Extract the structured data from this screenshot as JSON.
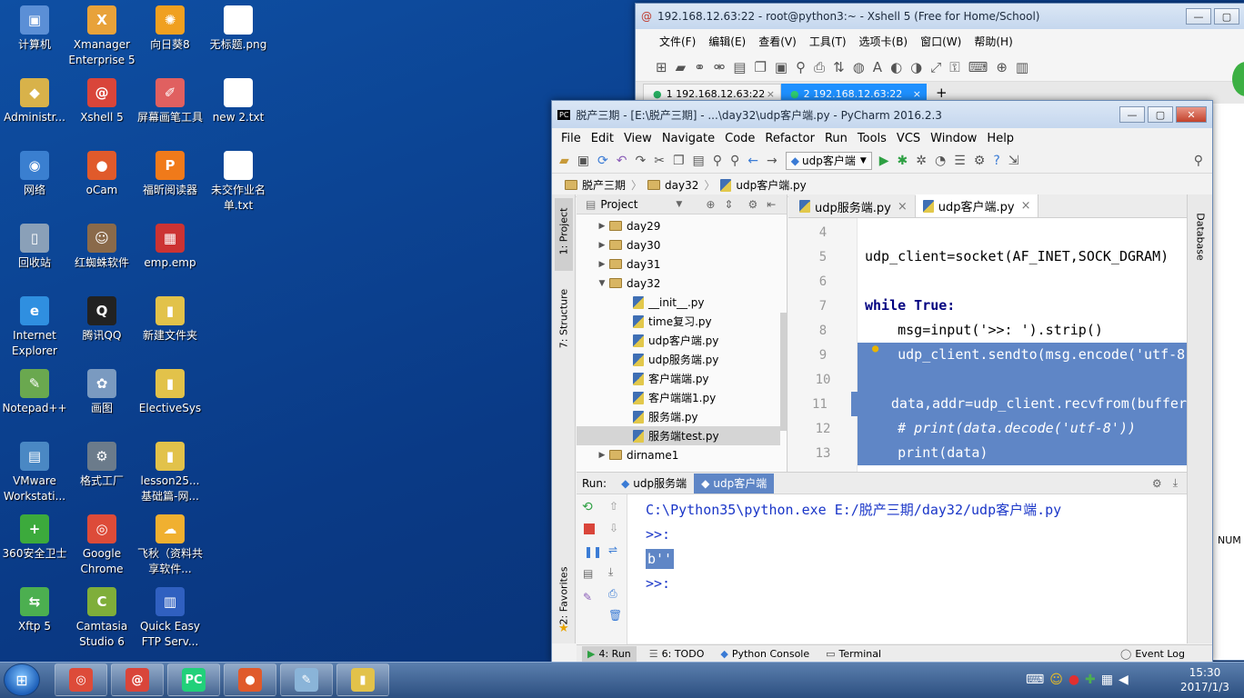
{
  "desktop": {
    "icons": [
      {
        "label": "计算机",
        "glyph": "▣",
        "color": "#5b8fd6"
      },
      {
        "label": "Administr...",
        "glyph": "◆",
        "color": "#d8b24a"
      },
      {
        "label": "网络",
        "glyph": "◉",
        "color": "#3a7fd0"
      },
      {
        "label": "回收站",
        "glyph": "▯",
        "color": "#8aa0b8"
      },
      {
        "label": "Internet Explorer",
        "glyph": "e",
        "color": "#2f8fe0"
      },
      {
        "label": "Notepad++",
        "glyph": "✎",
        "color": "#6aa84f"
      },
      {
        "label": "VMware Workstati...",
        "glyph": "▤",
        "color": "#4a88c4"
      },
      {
        "label": "360安全卫士",
        "glyph": "+",
        "color": "#3caa3c"
      },
      {
        "label": "Xftp 5",
        "glyph": "⇆",
        "color": "#4caf50"
      },
      {
        "label": "Xmanager Enterprise 5",
        "glyph": "X",
        "color": "#e8a23a"
      },
      {
        "label": "Xshell 5",
        "glyph": "@",
        "color": "#d9453a"
      },
      {
        "label": "oCam",
        "glyph": "●",
        "color": "#e05a2b"
      },
      {
        "label": "红蜘蛛软件",
        "glyph": "☺",
        "color": "#8a6a4a"
      },
      {
        "label": "腾讯QQ",
        "glyph": "Q",
        "color": "#222222"
      },
      {
        "label": "画图",
        "glyph": "✿",
        "color": "#7a9ac0"
      },
      {
        "label": "格式工厂",
        "glyph": "⚙",
        "color": "#6b7b8b"
      },
      {
        "label": "Google Chrome",
        "glyph": "◎",
        "color": "#dd4b39"
      },
      {
        "label": "Camtasia Studio 6",
        "glyph": "C",
        "color": "#7fae3a"
      },
      {
        "label": "向日葵8",
        "glyph": "✺",
        "color": "#f0a020"
      },
      {
        "label": "屏幕画笔工具",
        "glyph": "✐",
        "color": "#e06060"
      },
      {
        "label": "福昕阅读器",
        "glyph": "P",
        "color": "#f07a1a"
      },
      {
        "label": "emp.emp",
        "glyph": "▦",
        "color": "#cc3333"
      },
      {
        "label": "新建文件夹",
        "glyph": "▮",
        "color": "#e2c24a"
      },
      {
        "label": "ElectiveSys",
        "glyph": "▮",
        "color": "#e2c24a"
      },
      {
        "label": "lesson25...基础篇-网...",
        "glyph": "▮",
        "color": "#e2c24a"
      },
      {
        "label": "飞秋（资料共享软件...",
        "glyph": "☁",
        "color": "#f0b030"
      },
      {
        "label": "Quick Easy FTP Serv...",
        "glyph": "▥",
        "color": "#3060c0"
      },
      {
        "label": "无标题.png",
        "glyph": "▭",
        "color": "#ffffff"
      },
      {
        "label": "new 2.txt",
        "glyph": "▤",
        "color": "#ffffff"
      },
      {
        "label": "未交作业名单.txt",
        "glyph": "▤",
        "color": "#ffffff"
      }
    ]
  },
  "xshell": {
    "title": "192.168.12.63:22 - root@python3:~ - Xshell 5 (Free for Home/School)",
    "menu": [
      "文件(F)",
      "编辑(E)",
      "查看(V)",
      "工具(T)",
      "选项卡(B)",
      "窗口(W)",
      "帮助(H)"
    ],
    "tabs": [
      {
        "label": "1 192.168.12.63:22",
        "close": "×"
      },
      {
        "label": "2 192.168.12.63:22",
        "close": "×"
      }
    ],
    "add_tab": "+",
    "right_edge_text": "NUM"
  },
  "pycharm": {
    "title": "脱产三期 - [E:\\脱产三期] - ...\\day32\\udp客户端.py - PyCharm 2016.2.3",
    "menu": [
      "File",
      "Edit",
      "View",
      "Navigate",
      "Code",
      "Refactor",
      "Run",
      "Tools",
      "VCS",
      "Window",
      "Help"
    ],
    "run_config": "udp客户端",
    "breadcrumb": [
      "脱产三期",
      "day32",
      "udp客户端.py"
    ],
    "left_strip": {
      "project": "1: Project",
      "structure": "7: Structure",
      "favorites": "2: Favorites"
    },
    "right_strip": "Database",
    "project_header": "Project",
    "tree": [
      {
        "label": "day29",
        "kind": "folder",
        "depth": 0,
        "expanded": false
      },
      {
        "label": "day30",
        "kind": "folder",
        "depth": 0,
        "expanded": false
      },
      {
        "label": "day31",
        "kind": "folder",
        "depth": 0,
        "expanded": false
      },
      {
        "label": "day32",
        "kind": "folder",
        "depth": 0,
        "expanded": true
      },
      {
        "label": "__init__.py",
        "kind": "py",
        "depth": 1
      },
      {
        "label": "time复习.py",
        "kind": "py",
        "depth": 1
      },
      {
        "label": "udp客户端.py",
        "kind": "py",
        "depth": 1
      },
      {
        "label": "udp服务端.py",
        "kind": "py",
        "depth": 1
      },
      {
        "label": "客户端端.py",
        "kind": "py",
        "depth": 1
      },
      {
        "label": "客户端端1.py",
        "kind": "py",
        "depth": 1
      },
      {
        "label": "服务端.py",
        "kind": "py",
        "depth": 1
      },
      {
        "label": "服务端test.py",
        "kind": "py",
        "depth": 1,
        "selected": true
      },
      {
        "label": "dirname1",
        "kind": "folder",
        "depth": 0,
        "expanded": false
      }
    ],
    "editor_tabs": [
      {
        "label": "udp服务端.py",
        "close": "×",
        "active": false
      },
      {
        "label": "udp客户端.py",
        "close": "×",
        "active": true
      }
    ],
    "code": [
      {
        "num": "4",
        "text": "",
        "selected": false
      },
      {
        "num": "5",
        "text": "udp_client=socket(AF_INET,SOCK_DGRAM)",
        "selected": false
      },
      {
        "num": "6",
        "text": "",
        "selected": false
      },
      {
        "num": "7",
        "text": "while True:",
        "selected": false
      },
      {
        "num": "8",
        "text": "    msg=input('>>: ').strip()",
        "selected": false
      },
      {
        "num": "9",
        "text": "    udp_client.sendto(msg.encode('utf-8",
        "selected": true
      },
      {
        "num": "10",
        "text": "",
        "selected": true
      },
      {
        "num": "11",
        "text": "    data,addr=udp_client.recvfrom(buffer",
        "selected": true
      },
      {
        "num": "12",
        "text": "    # print(data.decode('utf-8'))",
        "selected": true
      },
      {
        "num": "13",
        "text": "    print(data)",
        "selected": true
      }
    ],
    "run_panel": {
      "label": "Run:",
      "tabs": [
        {
          "label": "udp服务端",
          "active": false
        },
        {
          "label": "udp客户端",
          "active": true
        }
      ],
      "output": [
        {
          "text": "C:\\Python35\\python.exe E:/脱产三期/day32/udp客户端.py",
          "highlight": false,
          "color": "#1a36c8"
        },
        {
          "text": ">>: ",
          "highlight": false,
          "color": "#1a36c8"
        },
        {
          "text": "b''",
          "highlight": true,
          "color": "#1a36c8"
        },
        {
          "text": ">>: ",
          "highlight": false,
          "color": "#1a36c8"
        }
      ]
    },
    "bottom_tabs": [
      "4: Run",
      "6: TODO",
      "Python Console",
      "Terminal"
    ],
    "event_log": "Event Log"
  },
  "taskbar": {
    "time": "15:30",
    "date": "2017/1/3",
    "apps": [
      {
        "name": "chrome",
        "glyph": "◎",
        "color": "#dd4b39"
      },
      {
        "name": "xshell",
        "glyph": "@",
        "color": "#d9453a"
      },
      {
        "name": "pycharm",
        "glyph": "PC",
        "color": "#21d07a"
      },
      {
        "name": "ocam",
        "glyph": "●",
        "color": "#e05a2b"
      },
      {
        "name": "notepad",
        "glyph": "✎",
        "color": "#8ab4d8"
      },
      {
        "name": "explorer",
        "glyph": "▮",
        "color": "#e2c24a"
      }
    ]
  }
}
